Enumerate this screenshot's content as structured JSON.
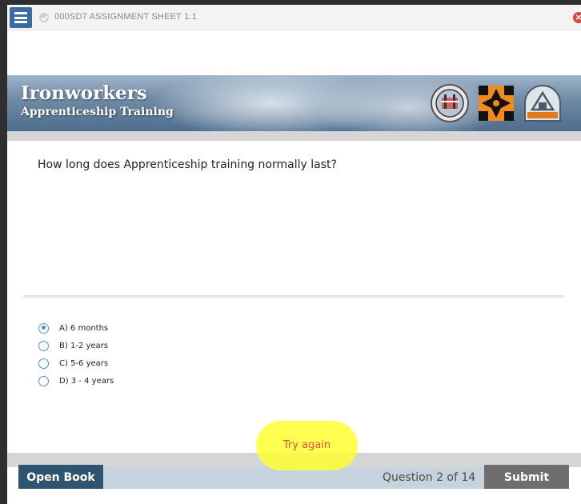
{
  "window": {
    "title": "000SD7 ASSIGNMENT SHEET 1.1"
  },
  "banner": {
    "title": "Ironworkers",
    "subtitle": "Apprenticeship Training"
  },
  "question": {
    "text": "How long does Apprenticeship training normally last?",
    "options": [
      {
        "label": "A) 6 months",
        "selected": true
      },
      {
        "label": "B) 1-2 years",
        "selected": false
      },
      {
        "label": "C) 5-6 years",
        "selected": false
      },
      {
        "label": "D) 3 - 4 years",
        "selected": false
      }
    ]
  },
  "feedback": {
    "text": "Try again"
  },
  "footer": {
    "open_book_label": "Open Book",
    "progress": "Question 2 of 14",
    "submit_label": "Submit"
  },
  "icons": {
    "menu": "hamburger-menu-icon",
    "status": "check-circle-icon",
    "close": "close-icon"
  },
  "colors": {
    "accent": "#3b6aa0",
    "footer_dark": "#2e5470",
    "submit": "#6e6e6e",
    "feedback_highlight": "#ffff33",
    "feedback_text": "#e0311f"
  }
}
